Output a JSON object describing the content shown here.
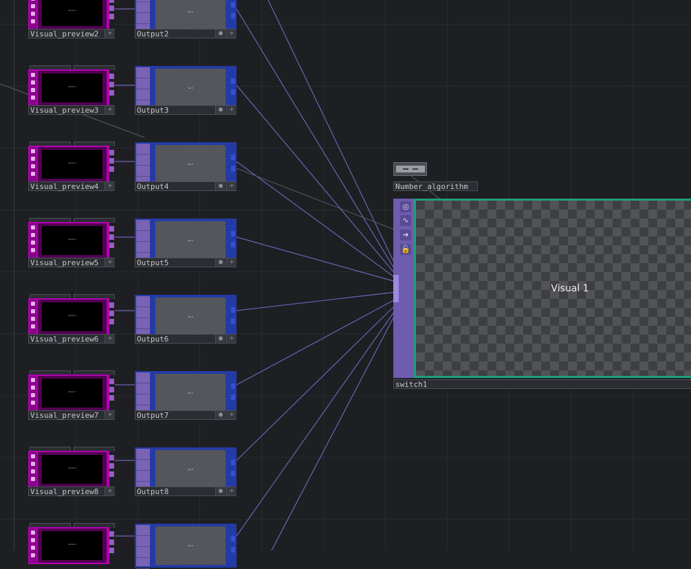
{
  "visual_previews": [
    {
      "label": "Visual_preview2",
      "thumb": "Visual 2"
    },
    {
      "label": "Visual_preview3",
      "thumb": "Visual 3"
    },
    {
      "label": "Visual_preview4",
      "thumb": "Visual 4"
    },
    {
      "label": "Visual_preview5",
      "thumb": "Visual 5"
    },
    {
      "label": "Visual_preview6",
      "thumb": "Visual 6"
    },
    {
      "label": "Visual_preview7",
      "thumb": "Visual 7"
    },
    {
      "label": "Visual_preview8",
      "thumb": "Visual 8"
    },
    {
      "label": "",
      "thumb": "Visual 9"
    }
  ],
  "outputs": [
    {
      "label": "Output2",
      "thumb": "Vis 2"
    },
    {
      "label": "Output3",
      "thumb": "Vis 3"
    },
    {
      "label": "Output4",
      "thumb": "Vis 4"
    },
    {
      "label": "Output5",
      "thumb": "Vis 5"
    },
    {
      "label": "Output6",
      "thumb": "Vis 6"
    },
    {
      "label": "Output7",
      "thumb": "Vis 7"
    },
    {
      "label": "Output8",
      "thumb": "Vis 8"
    },
    {
      "label": "",
      "thumb": "Vis 9"
    }
  ],
  "number_node": {
    "label": "Number_algorithm"
  },
  "switch_node": {
    "label": "switch1",
    "viewer_text": "Visual 1"
  },
  "colors": {
    "visual_comp": "#b200b2",
    "output_top": "#243ba6",
    "switch_strip": "#6e5cae",
    "active_border": "#1ea07a",
    "wire": "#6f64b4"
  },
  "icons": [
    "target-icon",
    "wave-icon",
    "arrow-right-icon",
    "lock-icon"
  ]
}
